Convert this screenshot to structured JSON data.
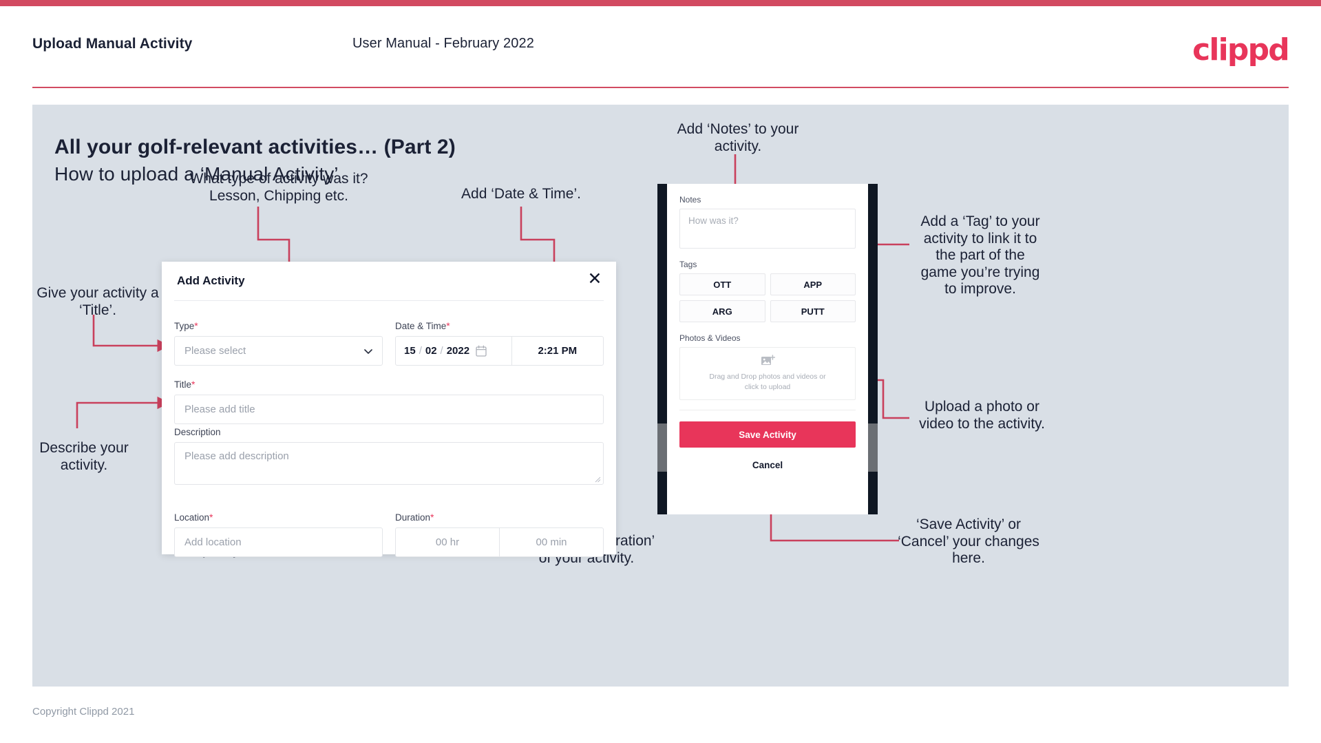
{
  "header": {
    "title": "Upload Manual Activity",
    "subtitle": "User Manual - February 2022",
    "logo": "clippd"
  },
  "slide": {
    "title": "All your golf-relevant activities… (Part 2)",
    "subtitle": "How to upload a ‘Manual Activity’"
  },
  "annotations": {
    "type": "What type of activity was it?\nLesson, Chipping etc.",
    "datetime": "Add ‘Date & Time’.",
    "title": "Give your activity a\n‘Title’.",
    "description": "Describe your\nactivity.",
    "location": "Specify the ‘Location’.",
    "duration": "Specify the ‘Duration’\nof your activity.",
    "notes": "Add ‘Notes’ to your\nactivity.",
    "tags": "Add a ‘Tag’ to your\nactivity to link it to\nthe part of the\ngame you’re trying\nto improve.",
    "upload": "Upload a photo or\nvideo to the activity.",
    "save": "‘Save Activity’ or\n‘Cancel’ your changes\nhere."
  },
  "dialog": {
    "title": "Add Activity",
    "close_icon": "close-icon",
    "fields": {
      "type": {
        "label": "Type",
        "required": "*",
        "placeholder": "Please select",
        "icon": "chevron-down-icon"
      },
      "datetime": {
        "label": "Date & Time",
        "required": "*",
        "day": "15",
        "month": "02",
        "year": "2022",
        "sep": "/",
        "time": "2:21 PM",
        "icon": "calendar-icon"
      },
      "title": {
        "label": "Title",
        "required": "*",
        "placeholder": "Please add title"
      },
      "description": {
        "label": "Description",
        "required": "",
        "placeholder": "Please add description"
      },
      "location": {
        "label": "Location",
        "required": "*",
        "placeholder": "Add location"
      },
      "duration": {
        "label": "Duration",
        "required": "*",
        "hours": "00 hr",
        "minutes": "00 min"
      }
    }
  },
  "phone": {
    "notes": {
      "label": "Notes",
      "placeholder": "How was it?"
    },
    "tags": {
      "label": "Tags",
      "items": [
        "OTT",
        "APP",
        "ARG",
        "PUTT"
      ]
    },
    "photos": {
      "label": "Photos & Videos",
      "icon": "add-image-icon",
      "dropzone_text": "Drag and Drop photos and videos or\nclick to upload"
    },
    "save_label": "Save Activity",
    "cancel_label": "Cancel"
  },
  "footer": {
    "copyright": "Copyright Clippd 2021"
  },
  "colors": {
    "brand": "#e8355a",
    "accent_bar": "#d24a61",
    "slide_bg": "#d9dfe6",
    "text_dark": "#1b2135",
    "connector": "#c9405c"
  }
}
